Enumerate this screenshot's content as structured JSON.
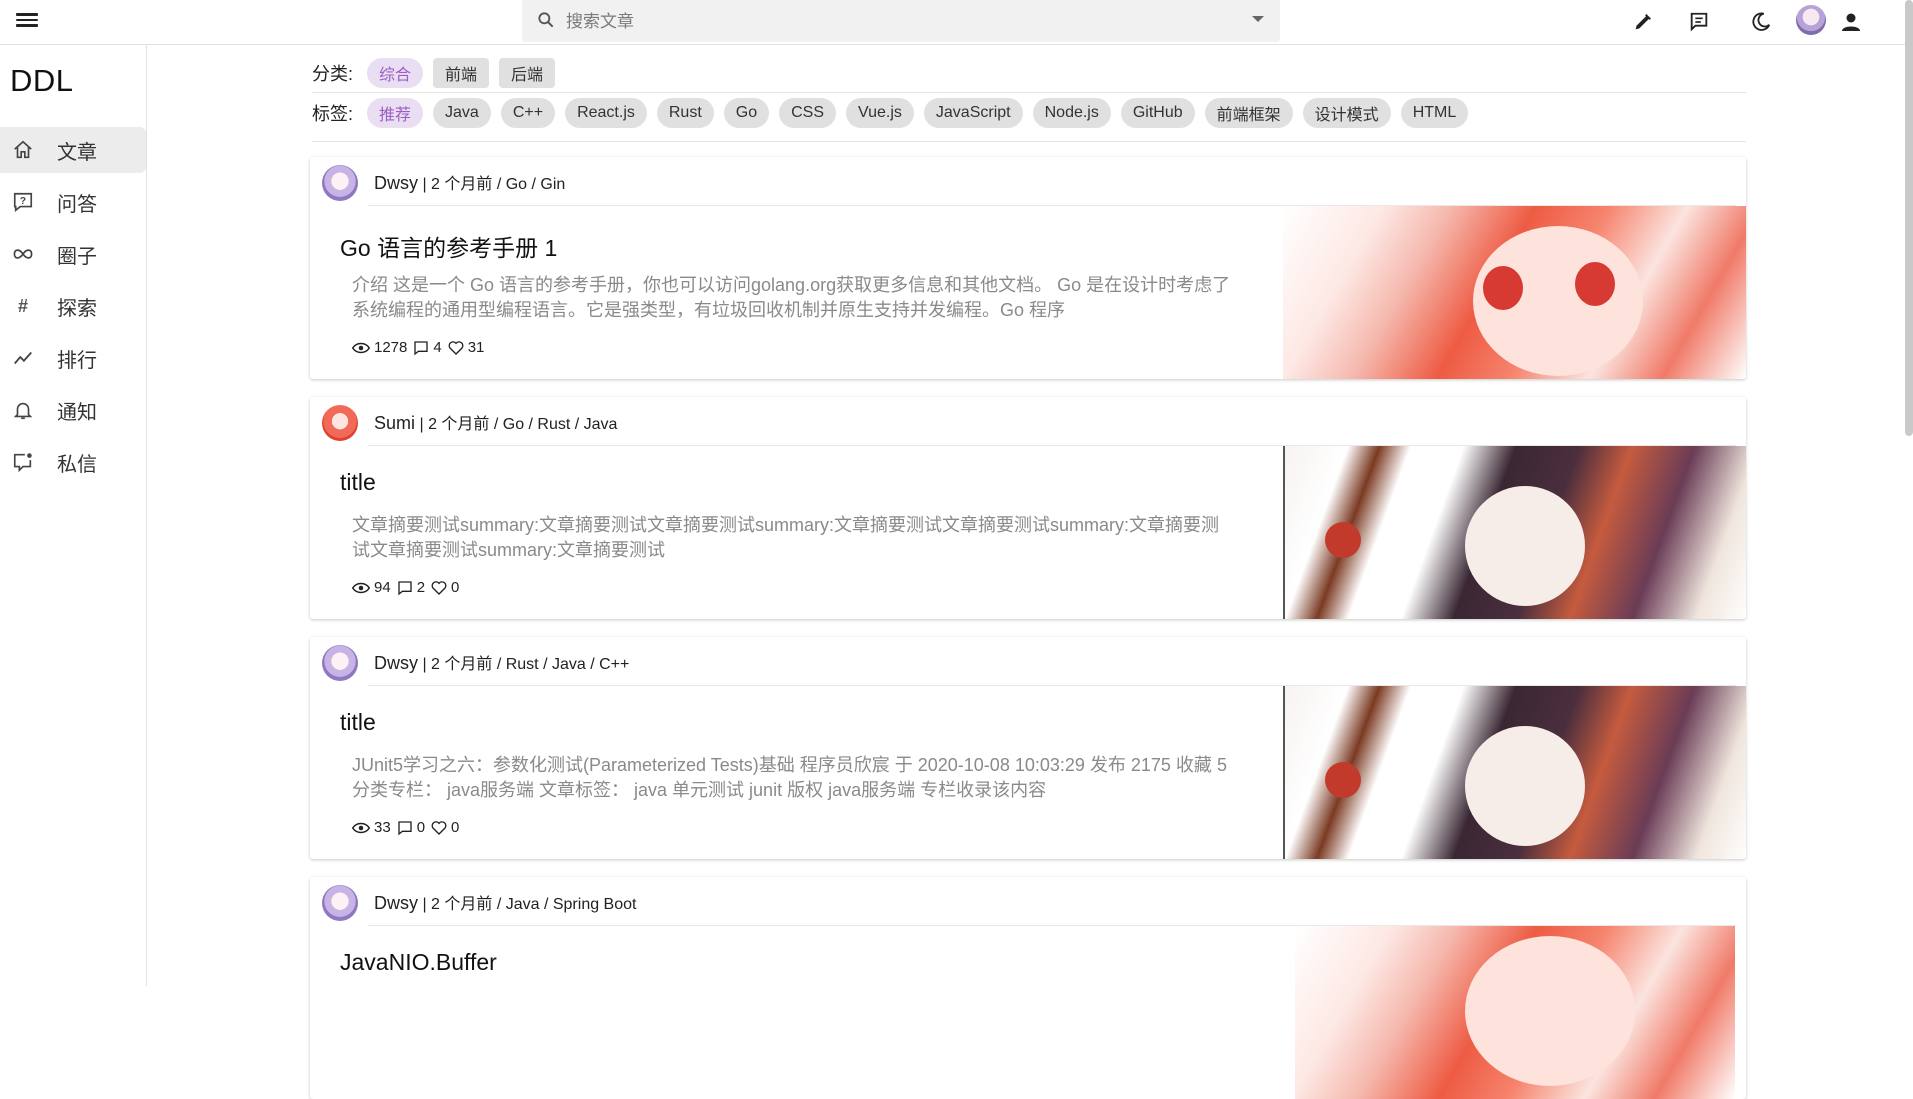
{
  "topbar": {
    "search_placeholder": "搜索文章",
    "icons": [
      "menu-icon",
      "search-icon",
      "dropdown-caret-icon",
      "pen-icon",
      "message-icon",
      "moon-icon",
      "avatar",
      "person-icon"
    ]
  },
  "sidebar": {
    "brand": "DDL",
    "items": [
      {
        "label": "文章",
        "icon": "home-icon",
        "active": true
      },
      {
        "label": "问答",
        "icon": "question-icon",
        "active": false
      },
      {
        "label": "圈子",
        "icon": "infinity-icon",
        "active": false
      },
      {
        "label": "探索",
        "icon": "hash-icon",
        "active": false
      },
      {
        "label": "排行",
        "icon": "trending-icon",
        "active": false
      },
      {
        "label": "通知",
        "icon": "bell-icon",
        "active": false
      },
      {
        "label": "私信",
        "icon": "chat-icon",
        "active": false
      }
    ]
  },
  "filters": {
    "category_label": "分类:",
    "categories": [
      "综合",
      "前端",
      "后端"
    ],
    "tag_label": "标签:",
    "tags": [
      "推荐",
      "Java",
      "C++",
      "React.js",
      "Rust",
      "Go",
      "CSS",
      "Vue.js",
      "JavaScript",
      "Node.js",
      "GitHub",
      "前端框架",
      "设计模式",
      "HTML"
    ]
  },
  "articles": [
    {
      "author": "Dwsy",
      "meta": " | 2 个月前 / Go / Gin",
      "title": "Go 语言的参考手册 1",
      "summary": "介绍 这是一个 Go 语言的参考手册，你也可以访问golang.org获取更多信息和其他文档。 Go 是在设计时考虑了系统编程的通用型编程语言。它是强类型，有垃圾回收机制并原生支持并发编程。Go 程序",
      "views": "1278",
      "comments": "4",
      "likes": "31"
    },
    {
      "author": "Sumi",
      "meta": " | 2 个月前 / Go / Rust / Java",
      "title": "title",
      "summary": "文章摘要测试summary:文章摘要测试文章摘要测试summary:文章摘要测试文章摘要测试summary:文章摘要测试文章摘要测试summary:文章摘要测试",
      "views": "94",
      "comments": "2",
      "likes": "0"
    },
    {
      "author": "Dwsy",
      "meta": " | 2 个月前 / Rust / Java / C++",
      "title": "title",
      "summary": "JUnit5学习之六：参数化测试(Parameterized Tests)基础 程序员欣宸 于 2020-10-08 10:03:29 发布 2175 收藏 5 分类专栏： java服务端 文章标签： java 单元测试 junit 版权 java服务端 专栏收录该内容",
      "views": "33",
      "comments": "0",
      "likes": "0"
    },
    {
      "author": "Dwsy",
      "meta": " | 2 个月前 / Java / Spring Boot",
      "title": "JavaNIO.Buffer"
    }
  ]
}
